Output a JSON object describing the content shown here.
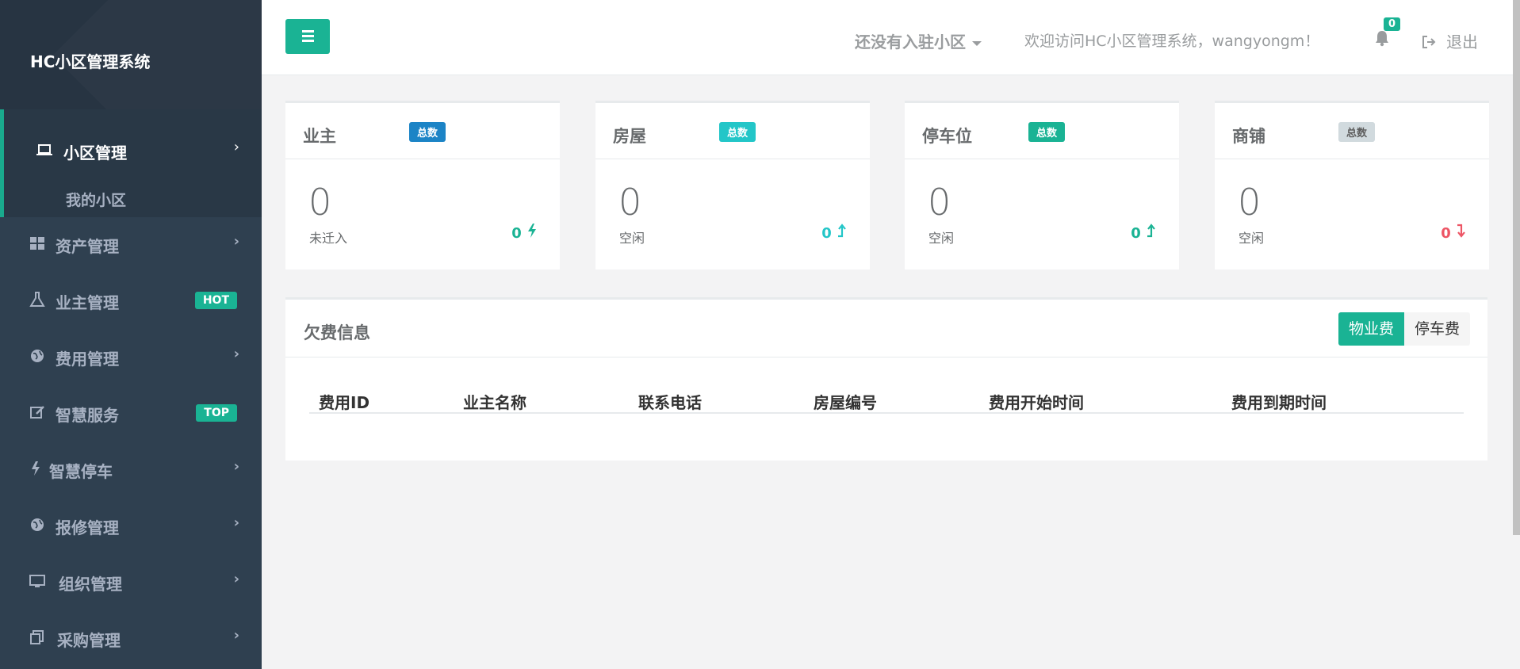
{
  "sidebar": {
    "brand": "HC小区管理系统",
    "active": {
      "label": "小区管理",
      "icon": "laptop-icon",
      "sub_item": "我的小区"
    },
    "items": [
      {
        "label": "资产管理",
        "icon": "th-large-icon",
        "badge": ""
      },
      {
        "label": "业主管理",
        "icon": "flask-icon",
        "badge": "HOT"
      },
      {
        "label": "费用管理",
        "icon": "globe-icon",
        "badge": ""
      },
      {
        "label": "智慧服务",
        "icon": "edit-icon",
        "badge": "TOP"
      },
      {
        "label": "智慧停车",
        "icon": "bolt-icon",
        "badge": ""
      },
      {
        "label": "报修管理",
        "icon": "globe-icon",
        "badge": ""
      },
      {
        "label": "组织管理",
        "icon": "desktop-icon",
        "badge": ""
      },
      {
        "label": "采购管理",
        "icon": "files-icon",
        "badge": ""
      }
    ]
  },
  "topbar": {
    "community_select": "还没有入驻小区",
    "welcome": "欢迎访问HC小区管理系统，wangyongm！",
    "notification_count": "0",
    "logout": "退出"
  },
  "cards": [
    {
      "title": "业主",
      "label": "总数",
      "label_color": "#1c84c6",
      "value": "0",
      "sub": "未迁入",
      "stat": "0",
      "stat_color": "#1ab394",
      "stat_icon": "bolt-icon"
    },
    {
      "title": "房屋",
      "label": "总数",
      "label_color": "#23c6c8",
      "value": "0",
      "sub": "空闲",
      "stat": "0",
      "stat_color": "#23c6c8",
      "stat_icon": "level-up-icon"
    },
    {
      "title": "停车位",
      "label": "总数",
      "label_color": "#1ab394",
      "value": "0",
      "sub": "空闲",
      "stat": "0",
      "stat_color": "#1ab394",
      "stat_icon": "level-up-icon"
    },
    {
      "title": "商铺",
      "label": "总数",
      "label_color": "#d1dade",
      "value": "0",
      "sub": "空闲",
      "stat": "0",
      "stat_color": "#ed5565",
      "stat_icon": "level-down-icon"
    }
  ],
  "arrears": {
    "title": "欠费信息",
    "tabs": [
      "物业费",
      "停车费"
    ],
    "columns": [
      "费用ID",
      "业主名称",
      "联系电话",
      "房屋编号",
      "费用开始时间",
      "费用到期时间"
    ]
  },
  "colors": {
    "accent": "#1ab394",
    "sidebar": "#2f4050"
  }
}
